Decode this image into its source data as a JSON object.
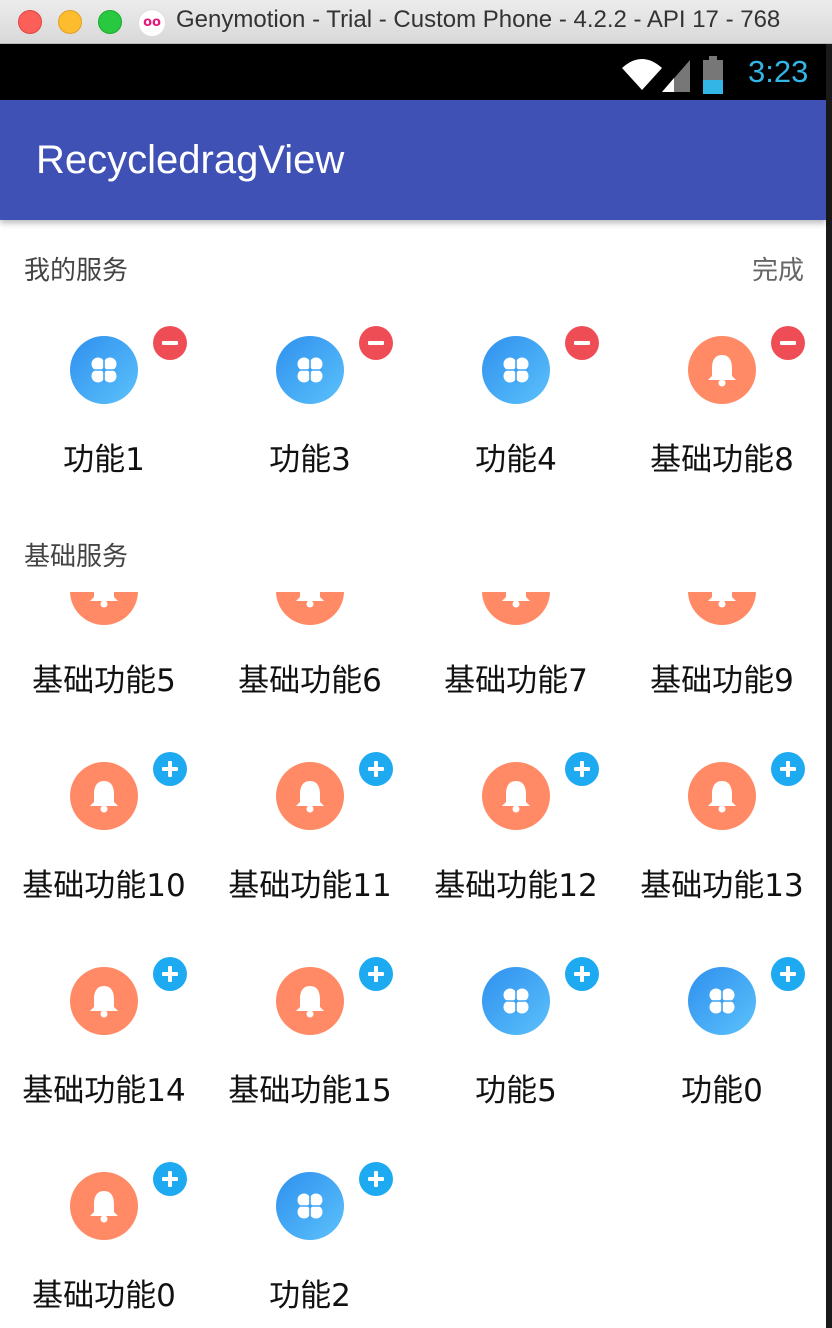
{
  "window": {
    "title": "Genymotion - Trial - Custom Phone - 4.2.2 - API 17 - 768"
  },
  "status_bar": {
    "time": "3:23"
  },
  "app_bar": {
    "title": "RecycledragView"
  },
  "my_services": {
    "title": "我的服务",
    "done_label": "完成",
    "items": [
      {
        "label": "功能1",
        "icon": "clover-icon",
        "color": "blue",
        "badge": "remove"
      },
      {
        "label": "功能3",
        "icon": "clover-icon",
        "color": "blue",
        "badge": "remove"
      },
      {
        "label": "功能4",
        "icon": "clover-icon",
        "color": "blue",
        "badge": "remove"
      },
      {
        "label": "基础功能8",
        "icon": "bell-icon",
        "color": "orange",
        "badge": "remove"
      }
    ]
  },
  "basic_services": {
    "title": "基础服务",
    "items": [
      {
        "label": "基础功能5",
        "icon": "bell-icon",
        "color": "orange",
        "badge": "none"
      },
      {
        "label": "基础功能6",
        "icon": "bell-icon",
        "color": "orange",
        "badge": "none"
      },
      {
        "label": "基础功能7",
        "icon": "bell-icon",
        "color": "orange",
        "badge": "none"
      },
      {
        "label": "基础功能9",
        "icon": "bell-icon",
        "color": "orange",
        "badge": "none"
      },
      {
        "label": "基础功能10",
        "icon": "bell-icon",
        "color": "orange",
        "badge": "add"
      },
      {
        "label": "基础功能11",
        "icon": "bell-icon",
        "color": "orange",
        "badge": "add"
      },
      {
        "label": "基础功能12",
        "icon": "bell-icon",
        "color": "orange",
        "badge": "add"
      },
      {
        "label": "基础功能13",
        "icon": "bell-icon",
        "color": "orange",
        "badge": "add"
      },
      {
        "label": "基础功能14",
        "icon": "bell-icon",
        "color": "orange",
        "badge": "add"
      },
      {
        "label": "基础功能15",
        "icon": "bell-icon",
        "color": "orange",
        "badge": "add"
      },
      {
        "label": "功能5",
        "icon": "clover-icon",
        "color": "blue",
        "badge": "add"
      },
      {
        "label": "功能0",
        "icon": "clover-icon",
        "color": "blue",
        "badge": "add"
      },
      {
        "label": "基础功能0",
        "icon": "bell-icon",
        "color": "orange",
        "badge": "add"
      },
      {
        "label": "功能2",
        "icon": "clover-icon",
        "color": "blue",
        "badge": "add"
      }
    ]
  },
  "colors": {
    "app_bar": "#3f51b5",
    "clock": "#33b5e5",
    "remove_badge": "#ef4d56",
    "add_badge": "#1eaaf1",
    "orange_icon": "#ff8a65",
    "blue_icon": "#3fa3f4"
  }
}
